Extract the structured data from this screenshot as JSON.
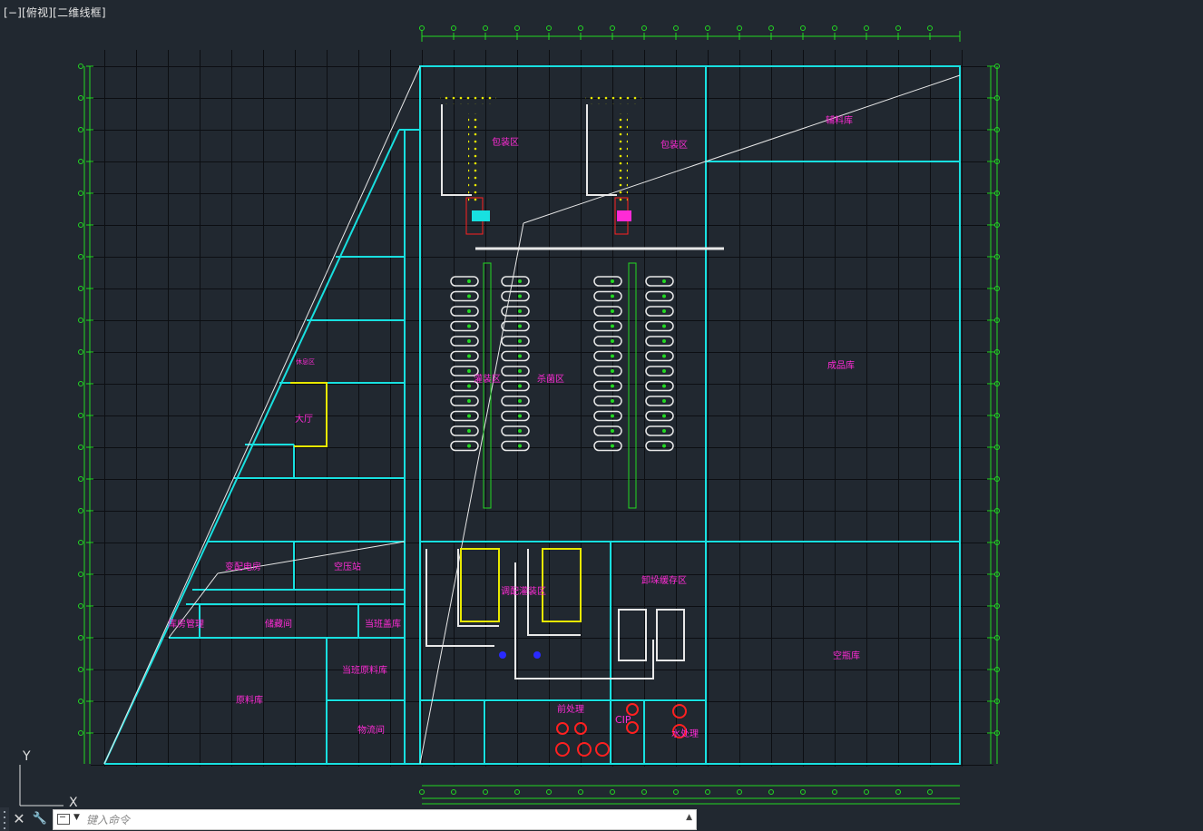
{
  "viewport": {
    "label": "[−][俯视][二维线框]"
  },
  "ucs": {
    "x_label": "X",
    "y_label": "Y"
  },
  "command_line": {
    "placeholder": "键入命令",
    "close_label": "✕",
    "customize_label": "🔧"
  },
  "colors": {
    "background": "#212830",
    "grid": "#0d0f12",
    "building_wall": "#18e0e0",
    "dimension": "#22d822",
    "label": "#ff2bd6",
    "equipment": "#e8e8e8",
    "conveyor": "#e8e800",
    "marker": "#ff2020"
  },
  "zones": [
    "包装区",
    "包装区",
    "杀菌区",
    "灌装区",
    "辅料库",
    "成品库",
    "调配灌装区",
    "卸垛缓存区",
    "空瓶库",
    "前处理",
    "CIP",
    "水处理",
    "大厅",
    "变配电房",
    "空压站",
    "库房管理",
    "储藏间",
    "当班盖库",
    "当班原料库",
    "原料库",
    "物流间",
    "休息区"
  ]
}
